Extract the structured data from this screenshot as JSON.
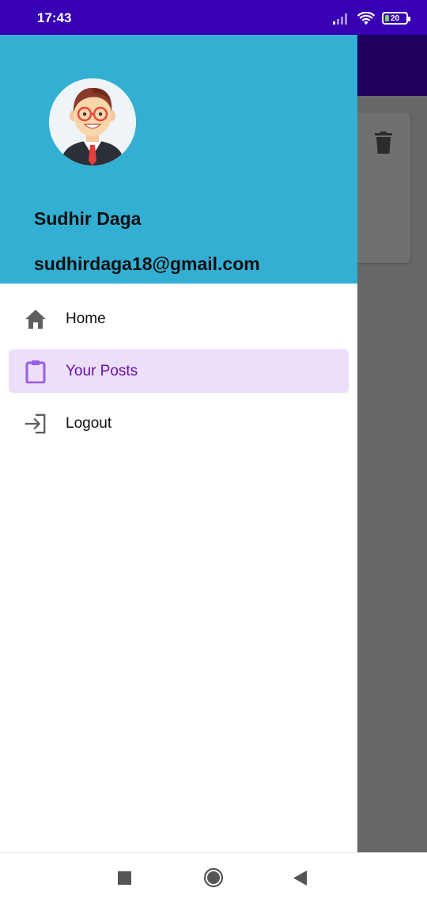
{
  "status_bar": {
    "time": "17:43",
    "battery_level": "20",
    "icons": [
      "signal-icon",
      "wifi-icon",
      "battery-icon"
    ]
  },
  "drawer": {
    "header_color": "#33afd4",
    "user": {
      "name": "Sudhir Daga",
      "email": "sudhirdaga18@gmail.com"
    },
    "items": [
      {
        "label": "Home",
        "icon": "home-icon",
        "active": false
      },
      {
        "label": "Your Posts",
        "icon": "clipboard-icon",
        "active": true
      },
      {
        "label": "Logout",
        "icon": "logout-icon",
        "active": false
      }
    ]
  },
  "background_app": {
    "toolbar_color": "#1f005d",
    "card_action_icon": "trash-icon"
  },
  "nav_bar": {
    "buttons": [
      "recents-button",
      "home-button",
      "back-button"
    ]
  },
  "colors": {
    "status_bar": "#3700b3",
    "active_item_bg": "#ecdffa",
    "active_item_text": "#6a0dad",
    "scrim": "#676767"
  }
}
